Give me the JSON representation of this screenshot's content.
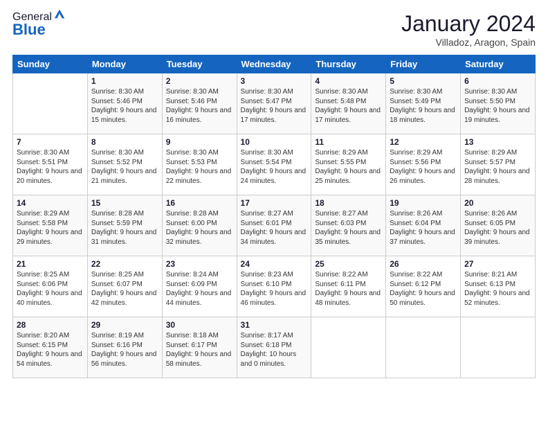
{
  "logo": {
    "general": "General",
    "blue": "Blue"
  },
  "header": {
    "month": "January 2024",
    "location": "Villadoz, Aragon, Spain"
  },
  "weekdays": [
    "Sunday",
    "Monday",
    "Tuesday",
    "Wednesday",
    "Thursday",
    "Friday",
    "Saturday"
  ],
  "weeks": [
    [
      {
        "day": "",
        "sunrise": "",
        "sunset": "",
        "daylight": ""
      },
      {
        "day": "1",
        "sunrise": "Sunrise: 8:30 AM",
        "sunset": "Sunset: 5:46 PM",
        "daylight": "Daylight: 9 hours and 15 minutes."
      },
      {
        "day": "2",
        "sunrise": "Sunrise: 8:30 AM",
        "sunset": "Sunset: 5:46 PM",
        "daylight": "Daylight: 9 hours and 16 minutes."
      },
      {
        "day": "3",
        "sunrise": "Sunrise: 8:30 AM",
        "sunset": "Sunset: 5:47 PM",
        "daylight": "Daylight: 9 hours and 17 minutes."
      },
      {
        "day": "4",
        "sunrise": "Sunrise: 8:30 AM",
        "sunset": "Sunset: 5:48 PM",
        "daylight": "Daylight: 9 hours and 17 minutes."
      },
      {
        "day": "5",
        "sunrise": "Sunrise: 8:30 AM",
        "sunset": "Sunset: 5:49 PM",
        "daylight": "Daylight: 9 hours and 18 minutes."
      },
      {
        "day": "6",
        "sunrise": "Sunrise: 8:30 AM",
        "sunset": "Sunset: 5:50 PM",
        "daylight": "Daylight: 9 hours and 19 minutes."
      }
    ],
    [
      {
        "day": "7",
        "sunrise": "Sunrise: 8:30 AM",
        "sunset": "Sunset: 5:51 PM",
        "daylight": "Daylight: 9 hours and 20 minutes."
      },
      {
        "day": "8",
        "sunrise": "Sunrise: 8:30 AM",
        "sunset": "Sunset: 5:52 PM",
        "daylight": "Daylight: 9 hours and 21 minutes."
      },
      {
        "day": "9",
        "sunrise": "Sunrise: 8:30 AM",
        "sunset": "Sunset: 5:53 PM",
        "daylight": "Daylight: 9 hours and 22 minutes."
      },
      {
        "day": "10",
        "sunrise": "Sunrise: 8:30 AM",
        "sunset": "Sunset: 5:54 PM",
        "daylight": "Daylight: 9 hours and 24 minutes."
      },
      {
        "day": "11",
        "sunrise": "Sunrise: 8:29 AM",
        "sunset": "Sunset: 5:55 PM",
        "daylight": "Daylight: 9 hours and 25 minutes."
      },
      {
        "day": "12",
        "sunrise": "Sunrise: 8:29 AM",
        "sunset": "Sunset: 5:56 PM",
        "daylight": "Daylight: 9 hours and 26 minutes."
      },
      {
        "day": "13",
        "sunrise": "Sunrise: 8:29 AM",
        "sunset": "Sunset: 5:57 PM",
        "daylight": "Daylight: 9 hours and 28 minutes."
      }
    ],
    [
      {
        "day": "14",
        "sunrise": "Sunrise: 8:29 AM",
        "sunset": "Sunset: 5:58 PM",
        "daylight": "Daylight: 9 hours and 29 minutes."
      },
      {
        "day": "15",
        "sunrise": "Sunrise: 8:28 AM",
        "sunset": "Sunset: 5:59 PM",
        "daylight": "Daylight: 9 hours and 31 minutes."
      },
      {
        "day": "16",
        "sunrise": "Sunrise: 8:28 AM",
        "sunset": "Sunset: 6:00 PM",
        "daylight": "Daylight: 9 hours and 32 minutes."
      },
      {
        "day": "17",
        "sunrise": "Sunrise: 8:27 AM",
        "sunset": "Sunset: 6:01 PM",
        "daylight": "Daylight: 9 hours and 34 minutes."
      },
      {
        "day": "18",
        "sunrise": "Sunrise: 8:27 AM",
        "sunset": "Sunset: 6:03 PM",
        "daylight": "Daylight: 9 hours and 35 minutes."
      },
      {
        "day": "19",
        "sunrise": "Sunrise: 8:26 AM",
        "sunset": "Sunset: 6:04 PM",
        "daylight": "Daylight: 9 hours and 37 minutes."
      },
      {
        "day": "20",
        "sunrise": "Sunrise: 8:26 AM",
        "sunset": "Sunset: 6:05 PM",
        "daylight": "Daylight: 9 hours and 39 minutes."
      }
    ],
    [
      {
        "day": "21",
        "sunrise": "Sunrise: 8:25 AM",
        "sunset": "Sunset: 6:06 PM",
        "daylight": "Daylight: 9 hours and 40 minutes."
      },
      {
        "day": "22",
        "sunrise": "Sunrise: 8:25 AM",
        "sunset": "Sunset: 6:07 PM",
        "daylight": "Daylight: 9 hours and 42 minutes."
      },
      {
        "day": "23",
        "sunrise": "Sunrise: 8:24 AM",
        "sunset": "Sunset: 6:09 PM",
        "daylight": "Daylight: 9 hours and 44 minutes."
      },
      {
        "day": "24",
        "sunrise": "Sunrise: 8:23 AM",
        "sunset": "Sunset: 6:10 PM",
        "daylight": "Daylight: 9 hours and 46 minutes."
      },
      {
        "day": "25",
        "sunrise": "Sunrise: 8:22 AM",
        "sunset": "Sunset: 6:11 PM",
        "daylight": "Daylight: 9 hours and 48 minutes."
      },
      {
        "day": "26",
        "sunrise": "Sunrise: 8:22 AM",
        "sunset": "Sunset: 6:12 PM",
        "daylight": "Daylight: 9 hours and 50 minutes."
      },
      {
        "day": "27",
        "sunrise": "Sunrise: 8:21 AM",
        "sunset": "Sunset: 6:13 PM",
        "daylight": "Daylight: 9 hours and 52 minutes."
      }
    ],
    [
      {
        "day": "28",
        "sunrise": "Sunrise: 8:20 AM",
        "sunset": "Sunset: 6:15 PM",
        "daylight": "Daylight: 9 hours and 54 minutes."
      },
      {
        "day": "29",
        "sunrise": "Sunrise: 8:19 AM",
        "sunset": "Sunset: 6:16 PM",
        "daylight": "Daylight: 9 hours and 56 minutes."
      },
      {
        "day": "30",
        "sunrise": "Sunrise: 8:18 AM",
        "sunset": "Sunset: 6:17 PM",
        "daylight": "Daylight: 9 hours and 58 minutes."
      },
      {
        "day": "31",
        "sunrise": "Sunrise: 8:17 AM",
        "sunset": "Sunset: 6:18 PM",
        "daylight": "Daylight: 10 hours and 0 minutes."
      },
      {
        "day": "",
        "sunrise": "",
        "sunset": "",
        "daylight": ""
      },
      {
        "day": "",
        "sunrise": "",
        "sunset": "",
        "daylight": ""
      },
      {
        "day": "",
        "sunrise": "",
        "sunset": "",
        "daylight": ""
      }
    ]
  ]
}
